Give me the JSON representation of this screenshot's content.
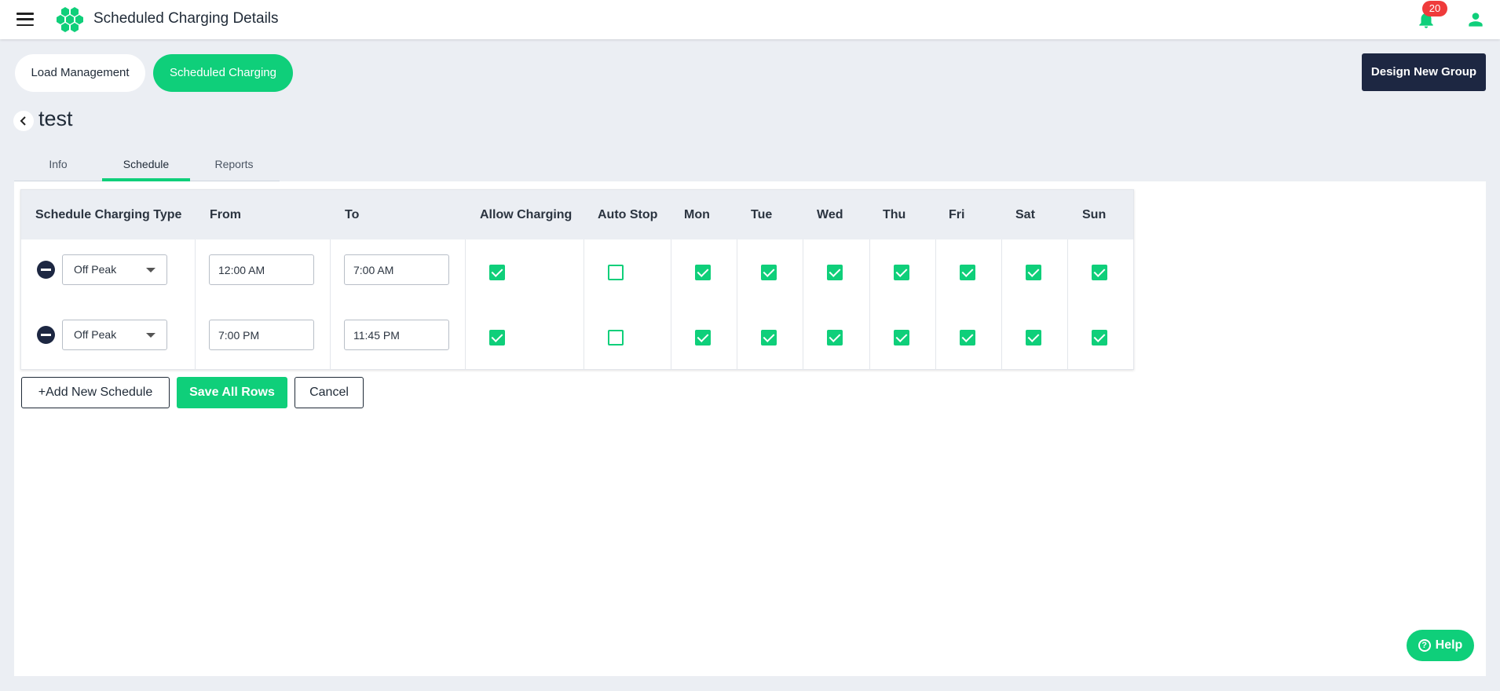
{
  "header": {
    "title": "Scheduled Charging Details",
    "notification_count": "20"
  },
  "segments": {
    "load_management": "Load Management",
    "scheduled_charging": "Scheduled Charging"
  },
  "design_new_group": "Design New Group",
  "group": {
    "name": "test"
  },
  "tabs": [
    "Info",
    "Schedule",
    "Reports"
  ],
  "active_tab": "Schedule",
  "table": {
    "columns": [
      "Schedule Charging Type",
      "From",
      "To",
      "Allow Charging",
      "Auto Stop",
      "Mon",
      "Tue",
      "Wed",
      "Thu",
      "Fri",
      "Sat",
      "Sun"
    ],
    "rows": [
      {
        "type": "Off Peak",
        "from": "12:00 AM",
        "to": "7:00 AM",
        "allow_charging": true,
        "auto_stop": false,
        "days": [
          true,
          true,
          true,
          true,
          true,
          true,
          true
        ]
      },
      {
        "type": "Off Peak",
        "from": "7:00 PM",
        "to": "11:45 PM",
        "allow_charging": true,
        "auto_stop": false,
        "days": [
          true,
          true,
          true,
          true,
          true,
          true,
          true
        ]
      }
    ]
  },
  "actions": {
    "add": "+Add New Schedule",
    "save": "Save All Rows",
    "cancel": "Cancel"
  },
  "help": "Help",
  "colors": {
    "accent": "#0fcf7a",
    "navy": "#1d2742",
    "badge": "#ef3b3b",
    "background": "#ebeef3"
  }
}
